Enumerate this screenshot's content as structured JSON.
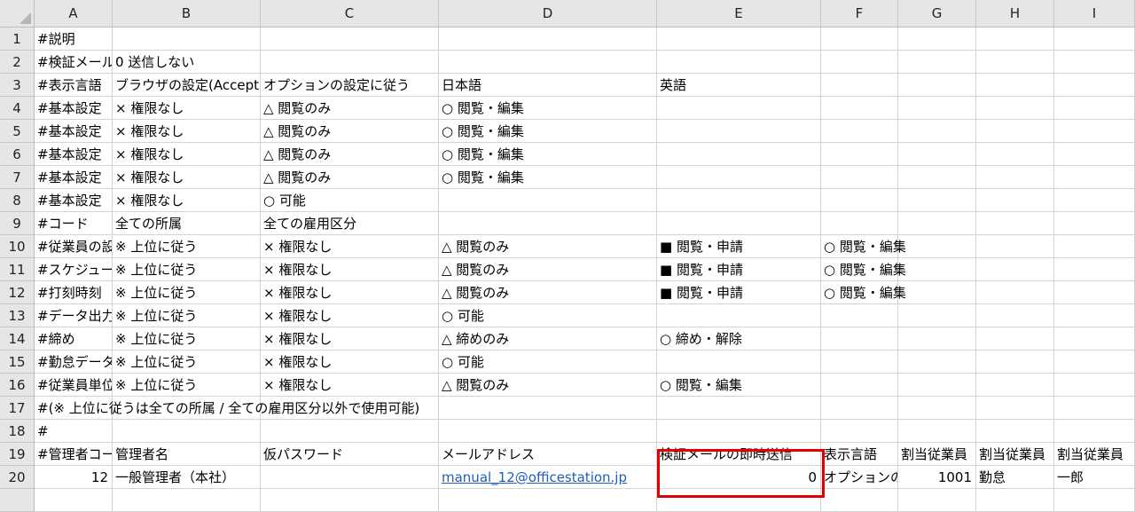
{
  "columns": [
    "A",
    "B",
    "C",
    "D",
    "E",
    "F",
    "G",
    "H",
    "I"
  ],
  "rows": [
    {
      "num": "1",
      "cells": [
        {
          "col": 0,
          "text": "#説明",
          "overflow": true
        }
      ]
    },
    {
      "num": "2",
      "cells": [
        {
          "col": 0,
          "text": "#検証メール"
        },
        {
          "col": 1,
          "text": "0 送信しない",
          "overflow": true
        }
      ]
    },
    {
      "num": "3",
      "cells": [
        {
          "col": 0,
          "text": "#表示言語"
        },
        {
          "col": 1,
          "text": "ブラウザの設定(Accept"
        },
        {
          "col": 2,
          "text": "オプションの設定に従う"
        },
        {
          "col": 3,
          "text": "日本語"
        },
        {
          "col": 4,
          "text": "英語"
        }
      ]
    },
    {
      "num": "4",
      "cells": [
        {
          "col": 0,
          "text": "#基本設定"
        },
        {
          "col": 1,
          "text": "× 権限なし"
        },
        {
          "col": 2,
          "text": "△ 閲覧のみ"
        },
        {
          "col": 3,
          "text": "○ 閲覧・編集"
        }
      ]
    },
    {
      "num": "5",
      "cells": [
        {
          "col": 0,
          "text": "#基本設定"
        },
        {
          "col": 1,
          "text": "× 権限なし"
        },
        {
          "col": 2,
          "text": "△ 閲覧のみ"
        },
        {
          "col": 3,
          "text": "○ 閲覧・編集"
        }
      ]
    },
    {
      "num": "6",
      "cells": [
        {
          "col": 0,
          "text": "#基本設定"
        },
        {
          "col": 1,
          "text": "× 権限なし"
        },
        {
          "col": 2,
          "text": "△ 閲覧のみ"
        },
        {
          "col": 3,
          "text": "○ 閲覧・編集"
        }
      ]
    },
    {
      "num": "7",
      "cells": [
        {
          "col": 0,
          "text": "#基本設定"
        },
        {
          "col": 1,
          "text": "× 権限なし"
        },
        {
          "col": 2,
          "text": "△ 閲覧のみ"
        },
        {
          "col": 3,
          "text": "○ 閲覧・編集"
        }
      ]
    },
    {
      "num": "8",
      "cells": [
        {
          "col": 0,
          "text": "#基本設定"
        },
        {
          "col": 1,
          "text": "× 権限なし"
        },
        {
          "col": 2,
          "text": "○ 可能"
        }
      ]
    },
    {
      "num": "9",
      "cells": [
        {
          "col": 0,
          "text": "#コード"
        },
        {
          "col": 1,
          "text": "全ての所属"
        },
        {
          "col": 2,
          "text": "全ての雇用区分"
        }
      ]
    },
    {
      "num": "10",
      "cells": [
        {
          "col": 0,
          "text": "#従業員の設"
        },
        {
          "col": 1,
          "text": "※ 上位に従う"
        },
        {
          "col": 2,
          "text": "× 権限なし"
        },
        {
          "col": 3,
          "text": "△ 閲覧のみ"
        },
        {
          "col": 4,
          "text": "■ 閲覧・申請"
        },
        {
          "col": 5,
          "text": "○ 閲覧・編集",
          "overflow": true
        }
      ]
    },
    {
      "num": "11",
      "cells": [
        {
          "col": 0,
          "text": "#スケジュー"
        },
        {
          "col": 1,
          "text": "※ 上位に従う"
        },
        {
          "col": 2,
          "text": "× 権限なし"
        },
        {
          "col": 3,
          "text": "△ 閲覧のみ"
        },
        {
          "col": 4,
          "text": "■ 閲覧・申請"
        },
        {
          "col": 5,
          "text": "○ 閲覧・編集",
          "overflow": true
        }
      ]
    },
    {
      "num": "12",
      "cells": [
        {
          "col": 0,
          "text": "#打刻時刻"
        },
        {
          "col": 1,
          "text": "※ 上位に従う"
        },
        {
          "col": 2,
          "text": "× 権限なし"
        },
        {
          "col": 3,
          "text": "△ 閲覧のみ"
        },
        {
          "col": 4,
          "text": "■ 閲覧・申請"
        },
        {
          "col": 5,
          "text": "○ 閲覧・編集",
          "overflow": true
        }
      ]
    },
    {
      "num": "13",
      "cells": [
        {
          "col": 0,
          "text": "#データ出力"
        },
        {
          "col": 1,
          "text": "※ 上位に従う"
        },
        {
          "col": 2,
          "text": "× 権限なし"
        },
        {
          "col": 3,
          "text": "○ 可能"
        }
      ]
    },
    {
      "num": "14",
      "cells": [
        {
          "col": 0,
          "text": "#締め"
        },
        {
          "col": 1,
          "text": "※ 上位に従う"
        },
        {
          "col": 2,
          "text": "× 権限なし"
        },
        {
          "col": 3,
          "text": "△ 締めのみ"
        },
        {
          "col": 4,
          "text": "○ 締め・解除"
        }
      ]
    },
    {
      "num": "15",
      "cells": [
        {
          "col": 0,
          "text": "#勤怠データ"
        },
        {
          "col": 1,
          "text": "※ 上位に従う"
        },
        {
          "col": 2,
          "text": "× 権限なし"
        },
        {
          "col": 3,
          "text": "○ 可能"
        }
      ]
    },
    {
      "num": "16",
      "cells": [
        {
          "col": 0,
          "text": "#従業員単位"
        },
        {
          "col": 1,
          "text": "※ 上位に従う"
        },
        {
          "col": 2,
          "text": "× 権限なし"
        },
        {
          "col": 3,
          "text": "△ 閲覧のみ"
        },
        {
          "col": 4,
          "text": "○ 閲覧・編集"
        }
      ]
    },
    {
      "num": "17",
      "cells": [
        {
          "col": 0,
          "text": "#(※ 上位に従うは全ての所属 / 全ての雇用区分以外で使用可能)",
          "overflow": true
        }
      ]
    },
    {
      "num": "18",
      "cells": [
        {
          "col": 0,
          "text": "#"
        }
      ]
    },
    {
      "num": "19",
      "cells": [
        {
          "col": 0,
          "text": "#管理者コー"
        },
        {
          "col": 1,
          "text": "管理者名"
        },
        {
          "col": 2,
          "text": "仮パスワード"
        },
        {
          "col": 3,
          "text": "メールアドレス"
        },
        {
          "col": 4,
          "text": "検証メールの即時送信"
        },
        {
          "col": 5,
          "text": "表示言語"
        },
        {
          "col": 6,
          "text": "割当従業員"
        },
        {
          "col": 7,
          "text": "割当従業員"
        },
        {
          "col": 8,
          "text": "割当従業員"
        }
      ]
    },
    {
      "num": "20",
      "cells": [
        {
          "col": 0,
          "text": "12",
          "align": "right"
        },
        {
          "col": 1,
          "text": "一般管理者（本社）"
        },
        {
          "col": 3,
          "text": "manual_12@officestation.jp",
          "link": true
        },
        {
          "col": 4,
          "text": "0",
          "align": "right"
        },
        {
          "col": 5,
          "text": "オプションの設定に従う"
        },
        {
          "col": 6,
          "text": "1001",
          "align": "right"
        },
        {
          "col": 7,
          "text": "勤怠"
        },
        {
          "col": 8,
          "text": "一郎"
        }
      ]
    },
    {
      "num": "",
      "cells": []
    }
  ],
  "highlight_label": "red-box-around-E19-E20",
  "colors": {
    "header_bg": "#e6e6e6",
    "grid": "#d4d4d4",
    "link": "#1f5fb8",
    "highlight": "#e00000"
  }
}
